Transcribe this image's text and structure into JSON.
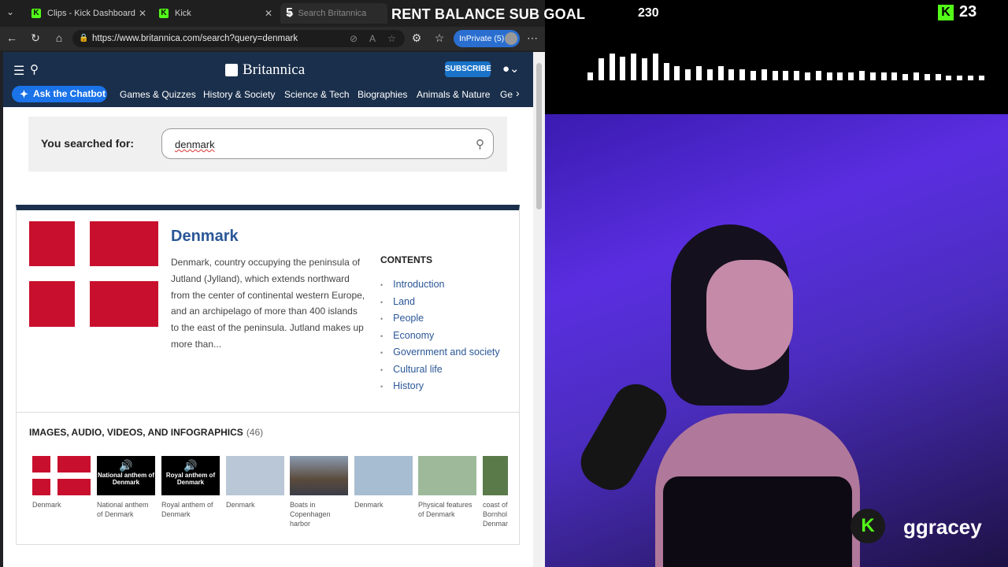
{
  "browser": {
    "tabs": [
      {
        "label": "Clips - Kick Dashboard"
      },
      {
        "label": "Kick"
      },
      {
        "label": "Search Britannica"
      }
    ],
    "url": "https://www.britannica.com/search?query=denmark",
    "inprivate_label": "InPrivate (5)"
  },
  "site": {
    "logo": "Britannica",
    "subscribe_label": "SUBSCRIBE",
    "chatbot_label": "Ask the Chatbot",
    "nav": [
      "Games & Quizzes",
      "History & Society",
      "Science & Tech",
      "Biographies",
      "Animals & Nature",
      "Ge"
    ]
  },
  "search": {
    "label": "You searched for:",
    "query": "denmark"
  },
  "result": {
    "title": "Denmark",
    "description": "Denmark, country occupying the peninsula of Jutland (Jylland), which extends northward from the center of continental western Europe, and an archipelago of more than 400 islands to the east of the peninsula. Jutland makes up more than...",
    "contents_heading": "CONTENTS",
    "contents": [
      "Introduction",
      "Land",
      "People",
      "Economy",
      "Government and society",
      "Cultural life",
      "History"
    ]
  },
  "media": {
    "heading": "IMAGES, AUDIO, VIDEOS, AND INFOGRAPHICS",
    "count": "(46)",
    "items": [
      {
        "caption": "Denmark"
      },
      {
        "caption": "National anthem of Denmark",
        "thumb_text": "National anthem of Denmark"
      },
      {
        "caption": "Royal anthem of Denmark",
        "thumb_text": "Royal anthem of Denmark"
      },
      {
        "caption": "Denmark"
      },
      {
        "caption": "Boats in Copenhagen harbor"
      },
      {
        "caption": "Denmark"
      },
      {
        "caption": "Physical features of Denmark"
      },
      {
        "caption": "coast of Bornhol Denmar"
      }
    ]
  },
  "stream": {
    "goal_title": "RENT BALANCE SUB GOAL",
    "goal_current": "5",
    "goal_target": "230",
    "viewer_count": "23",
    "username": "ggracey",
    "kick_logo_letter": "K"
  },
  "colors": {
    "kick_green": "#53fc18",
    "britannica_navy": "#1a2f4b",
    "link_blue": "#2b5797",
    "flag_red": "#c8102e"
  }
}
